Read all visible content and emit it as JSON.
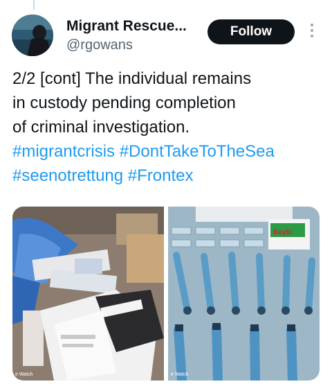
{
  "author": {
    "display_name": "Migrant Rescue...",
    "handle": "@rgowans"
  },
  "follow_label": "Follow",
  "tweet": {
    "lines": [
      "2/2 [cont] The individual remains",
      "in custody pending completion",
      "of criminal investigation."
    ],
    "hashtags_line1": [
      "#migrantcrisis",
      "#DontTakeToTheSea"
    ],
    "hashtags_line2": [
      "#seenotrettung",
      "#Frontex"
    ]
  },
  "media": {
    "photo1_watermark": "e Watch",
    "photo2_watermark": "e Watch",
    "photo2_box_label": "Beybi"
  },
  "colors": {
    "link": "#1d9bf0",
    "text": "#0f1419",
    "secondary": "#536471",
    "follow_bg": "#0f1419"
  },
  "icons": [
    "more-options-icon"
  ]
}
